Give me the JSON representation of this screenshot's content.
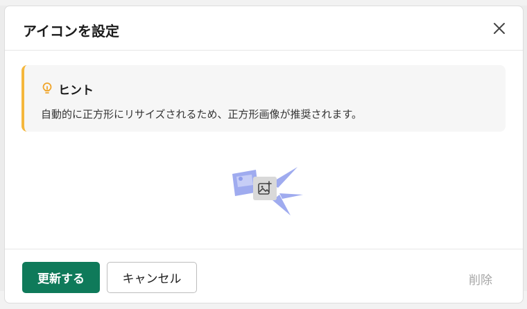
{
  "modal": {
    "title": "アイコンを設定",
    "close_icon": "close-icon"
  },
  "hint": {
    "icon": "lightbulb-icon",
    "title": "ヒント",
    "text": "自動的に正方形にリサイズされるため、正方形画像が推奨されます。",
    "accent_color": "#f5b73c"
  },
  "upload": {
    "icon": "image-plus-icon"
  },
  "footer": {
    "update_label": "更新する",
    "cancel_label": "キャンセル",
    "delete_label": "削除"
  },
  "colors": {
    "primary": "#0f7a5a",
    "illustration": "#8e9cec"
  }
}
